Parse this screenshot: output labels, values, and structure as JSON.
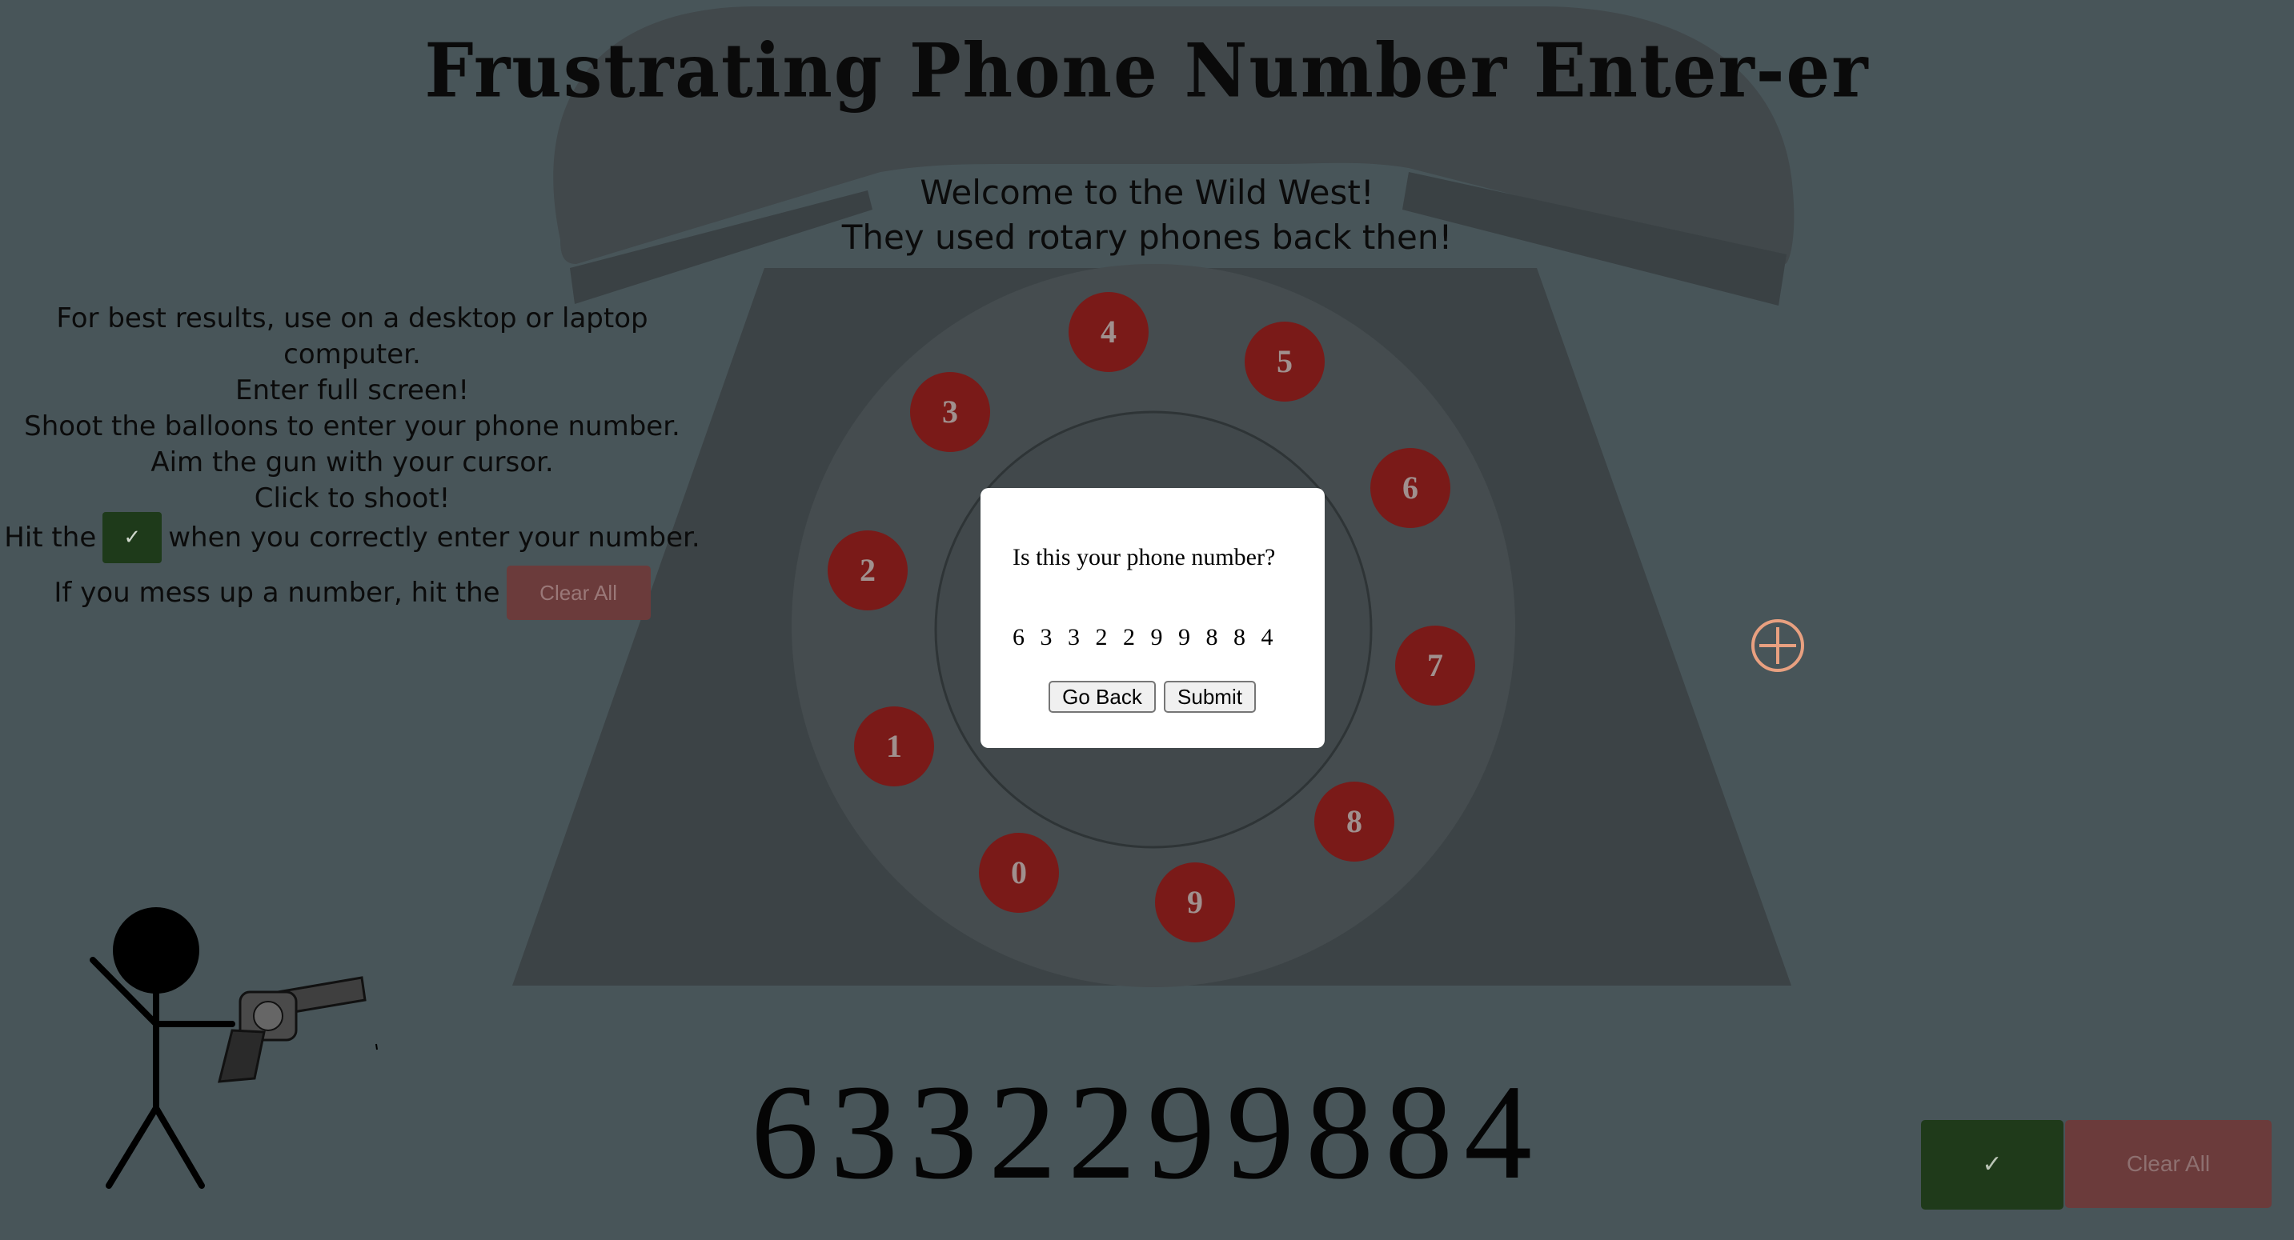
{
  "header": {
    "title": "Frustrating Phone Number Enter-er",
    "welcome_line1": "Welcome to the Wild West!",
    "welcome_line2": "They used rotary phones back then!"
  },
  "instructions": {
    "line1": "For best results, use on a desktop or laptop computer.",
    "line2": "Enter full screen!",
    "line3": "Shoot the balloons to enter your phone number.",
    "line4": "Aim the gun with your cursor.",
    "line5": "Click to shoot!",
    "hit_prefix": "Hit the",
    "hit_suffix": "when you correctly enter your number.",
    "mess_prefix": "If you mess up a number, hit the",
    "check_symbol": "✓",
    "clear_label": "Clear All"
  },
  "dial": {
    "balloons": [
      "4",
      "5",
      "3",
      "6",
      "2",
      "7",
      "1",
      "8",
      "0",
      "9"
    ]
  },
  "modal": {
    "question": "Is this your phone number?",
    "number": "6 3 3 2 2 9 9 8 8 4",
    "go_back_label": "Go Back",
    "submit_label": "Submit"
  },
  "entered_number": "6332299884",
  "controls": {
    "check_label": "✓",
    "clear_label": "Clear All"
  },
  "icons": {
    "crosshair": "crosshair-icon",
    "stick_figure": "stick-figure-icon",
    "revolver": "revolver-icon"
  },
  "colors": {
    "background": "#485559",
    "balloon": "#7a1a18",
    "check_button": "#1f3a1a",
    "clear_button": "#6b3b3b",
    "crosshair": "#e8a080"
  }
}
